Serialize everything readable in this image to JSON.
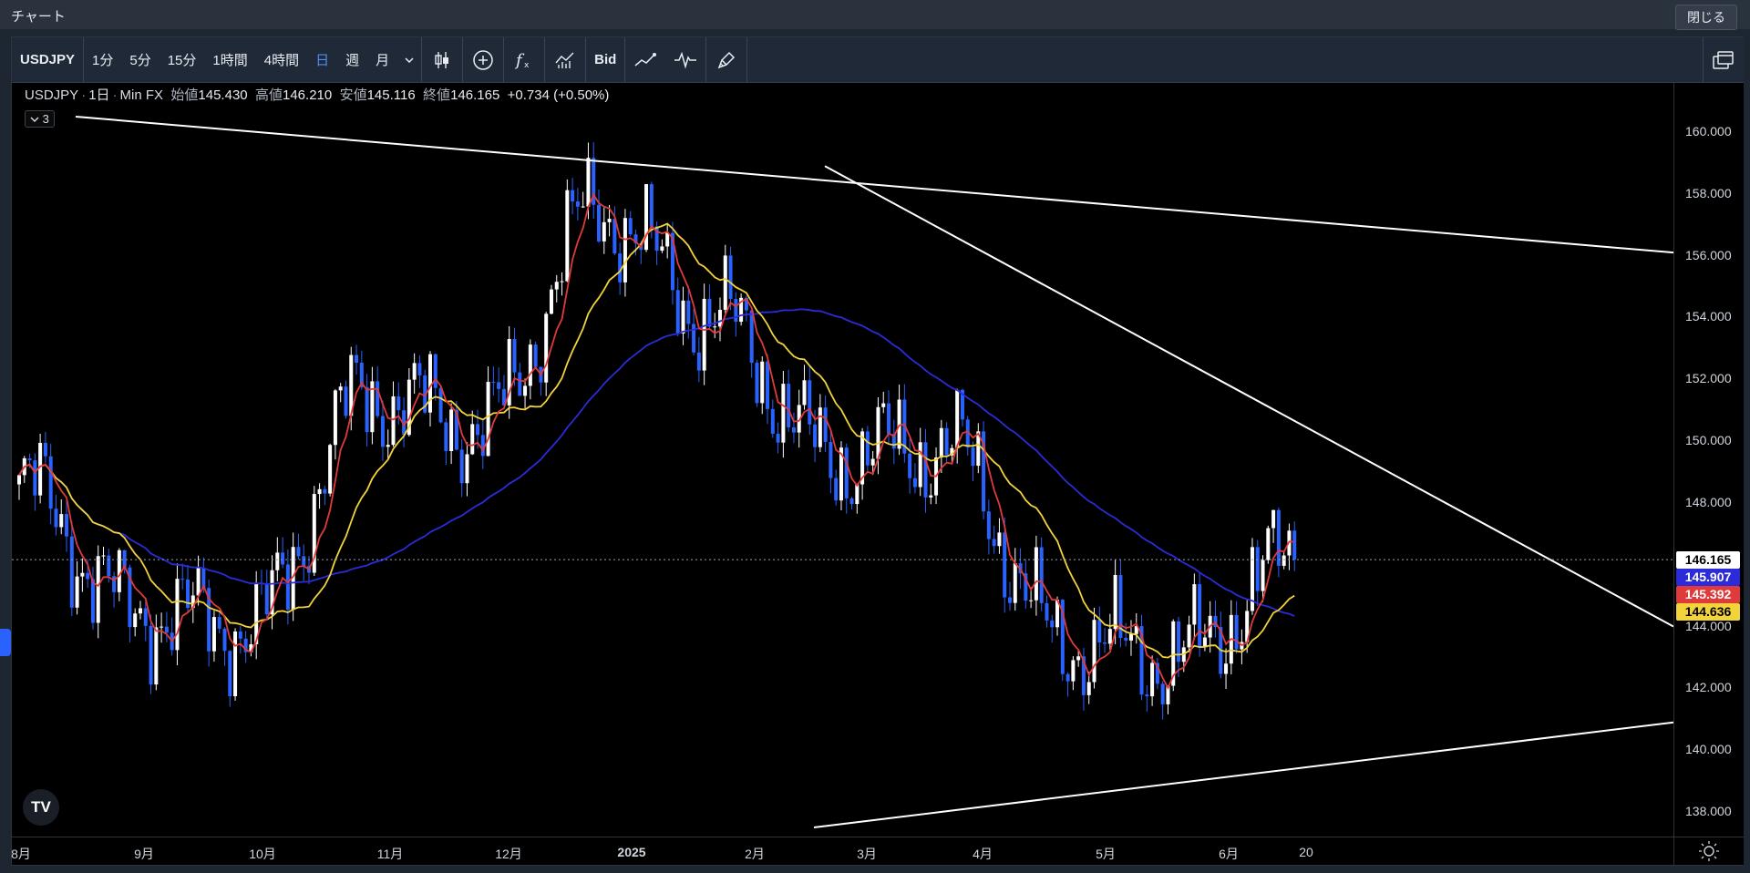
{
  "window": {
    "title": "チャート",
    "close_label": "閉じる"
  },
  "toolbar": {
    "symbol": "USDJPY",
    "intervals": [
      "1分",
      "5分",
      "15分",
      "1時間",
      "4時間",
      "日",
      "週",
      "月"
    ],
    "active_interval": "日",
    "bid_label": "Bid"
  },
  "legend": {
    "symbol": "USDJPY",
    "interval": "1日",
    "source": "Min FX",
    "open_label": "始値",
    "open": "145.430",
    "high_label": "高値",
    "high": "146.210",
    "low_label": "安値",
    "low": "145.116",
    "close_label": "終値",
    "close": "146.165",
    "change": "+0.734 (+0.50%)",
    "indicators_count": "3"
  },
  "price_tags": [
    {
      "value": "146.165",
      "bg": "#ffffff",
      "fg": "#000000"
    },
    {
      "value": "145.907",
      "bg": "#2b2bd9",
      "fg": "#ffffff"
    },
    {
      "value": "145.392",
      "bg": "#e03a3a",
      "fg": "#ffffff"
    },
    {
      "value": "144.636",
      "bg": "#f2d33a",
      "fg": "#000000"
    }
  ],
  "chart_data": {
    "type": "candlestick",
    "symbol": "USDJPY",
    "y_ticks": [
      "160.000",
      "158.000",
      "156.000",
      "154.000",
      "152.000",
      "150.000",
      "148.000",
      "146.000",
      "144.000",
      "142.000",
      "140.000",
      "138.000"
    ],
    "x_ticks": [
      "8月",
      "9月",
      "10月",
      "11月",
      "12月",
      "2025",
      "2月",
      "3月",
      "4月",
      "5月",
      "6月",
      "20"
    ],
    "ylim": [
      137.5,
      161.0
    ],
    "monthly_close_path": [
      {
        "x": "8月",
        "y": 148.5
      },
      {
        "x": "9月",
        "y": 144.5
      },
      {
        "x": "10月",
        "y": 144.0
      },
      {
        "x": "11月",
        "y": 151.5
      },
      {
        "x": "12月",
        "y": 150.5
      },
      {
        "x": "2025",
        "y": 157.5
      },
      {
        "x": "2月",
        "y": 154.0
      },
      {
        "x": "3月",
        "y": 149.5
      },
      {
        "x": "4月",
        "y": 149.8
      },
      {
        "x": "5月",
        "y": 143.5
      },
      {
        "x": "6月",
        "y": 143.0
      },
      {
        "x": "20",
        "y": 146.165
      }
    ],
    "series": [
      {
        "name": "MA (red)",
        "color": "#e03a3a",
        "last": 145.392
      },
      {
        "name": "MA (yellow)",
        "color": "#f2d33a",
        "last": 144.636
      },
      {
        "name": "MA (blue)",
        "color": "#2b2bd9",
        "last": 145.907
      }
    ],
    "last_price": 146.165,
    "grid": false,
    "colors": {
      "up": "#ffffff",
      "down": "#2962ff",
      "background": "#000000"
    }
  }
}
